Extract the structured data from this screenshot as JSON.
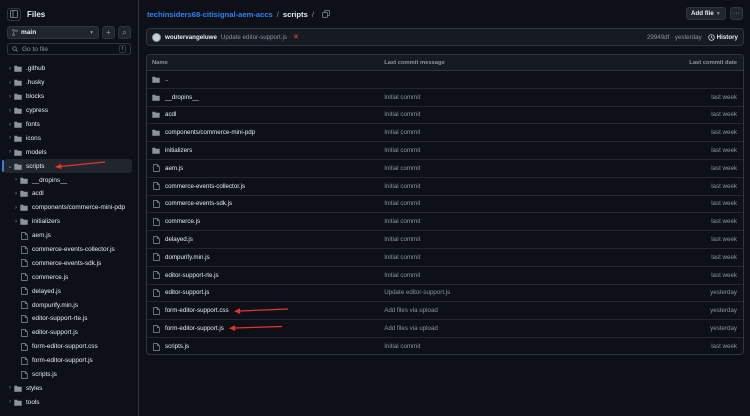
{
  "sidebar": {
    "title": "Files",
    "branch": "main",
    "add_glyph": "+",
    "search_glyph": "⌕",
    "goto_placeholder": "Go to file",
    "goto_kbd": "t",
    "tree": [
      {
        "name": ".github",
        "type": "folder",
        "depth": 0,
        "open": false
      },
      {
        "name": ".husky",
        "type": "folder",
        "depth": 0,
        "open": false
      },
      {
        "name": "blocks",
        "type": "folder",
        "depth": 0,
        "open": false
      },
      {
        "name": "cypress",
        "type": "folder",
        "depth": 0,
        "open": false
      },
      {
        "name": "fonts",
        "type": "folder",
        "depth": 0,
        "open": false
      },
      {
        "name": "icons",
        "type": "folder",
        "depth": 0,
        "open": false
      },
      {
        "name": "models",
        "type": "folder",
        "depth": 0,
        "open": false
      },
      {
        "name": "scripts",
        "type": "folder",
        "depth": 0,
        "open": true,
        "selected": true
      },
      {
        "name": "__dropins__",
        "type": "folder",
        "depth": 1,
        "open": false
      },
      {
        "name": "acdl",
        "type": "folder",
        "depth": 1,
        "open": false
      },
      {
        "name": "components/commerce-mini-pdp",
        "type": "folder",
        "depth": 1,
        "open": false
      },
      {
        "name": "initializers",
        "type": "folder",
        "depth": 1,
        "open": false
      },
      {
        "name": "aem.js",
        "type": "file",
        "depth": 1
      },
      {
        "name": "commerce-events-collector.js",
        "type": "file",
        "depth": 1
      },
      {
        "name": "commerce-events-sdk.js",
        "type": "file",
        "depth": 1
      },
      {
        "name": "commerce.js",
        "type": "file",
        "depth": 1
      },
      {
        "name": "delayed.js",
        "type": "file",
        "depth": 1
      },
      {
        "name": "dompurify.min.js",
        "type": "file",
        "depth": 1
      },
      {
        "name": "editor-support-rte.js",
        "type": "file",
        "depth": 1
      },
      {
        "name": "editor-support.js",
        "type": "file",
        "depth": 1
      },
      {
        "name": "form-editor-support.css",
        "type": "file",
        "depth": 1
      },
      {
        "name": "form-editor-support.js",
        "type": "file",
        "depth": 1
      },
      {
        "name": "scripts.js",
        "type": "file",
        "depth": 1
      },
      {
        "name": "styles",
        "type": "folder",
        "depth": 0,
        "open": false
      },
      {
        "name": "tools",
        "type": "folder",
        "depth": 0,
        "open": false
      }
    ]
  },
  "header": {
    "repo": "techinsiders68-citisignal-aem-accs",
    "sep": "/",
    "dir": "scripts",
    "add_file_label": "Add file",
    "more_glyph": "···"
  },
  "commit": {
    "user": "woutervangeluwe",
    "message": "Update editor-support.js",
    "status_glyph": "✕",
    "sha_time": "29949df · yesterday",
    "history_label": "History"
  },
  "table": {
    "headers": {
      "name": "Name",
      "message": "Last commit message",
      "date": "Last commit date"
    },
    "rows": [
      {
        "name": "..",
        "type": "parent",
        "message": "",
        "date": ""
      },
      {
        "name": "__dropins__",
        "type": "folder",
        "message": "Initial commit",
        "date": "last week"
      },
      {
        "name": "acdl",
        "type": "folder",
        "message": "Initial commit",
        "date": "last week"
      },
      {
        "name": "components/commerce-mini-pdp",
        "type": "folder",
        "message": "Initial commit",
        "date": "last week"
      },
      {
        "name": "initializers",
        "type": "folder",
        "message": "Initial commit",
        "date": "last week"
      },
      {
        "name": "aem.js",
        "type": "file",
        "message": "Initial commit",
        "date": "last week"
      },
      {
        "name": "commerce-events-collector.js",
        "type": "file",
        "message": "Initial commit",
        "date": "last week"
      },
      {
        "name": "commerce-events-sdk.js",
        "type": "file",
        "message": "Initial commit",
        "date": "last week"
      },
      {
        "name": "commerce.js",
        "type": "file",
        "message": "Initial commit",
        "date": "last week"
      },
      {
        "name": "delayed.js",
        "type": "file",
        "message": "Initial commit",
        "date": "last week"
      },
      {
        "name": "dompurify.min.js",
        "type": "file",
        "message": "Initial commit",
        "date": "last week"
      },
      {
        "name": "editor-support-rte.js",
        "type": "file",
        "message": "Initial commit",
        "date": "last week"
      },
      {
        "name": "editor-support.js",
        "type": "file",
        "message": "Update editor-support.js",
        "date": "yesterday"
      },
      {
        "name": "form-editor-support.css",
        "type": "file",
        "message": "Add files via upload",
        "date": "yesterday"
      },
      {
        "name": "form-editor-support.js",
        "type": "file",
        "message": "Add files via upload",
        "date": "yesterday"
      },
      {
        "name": "scripts.js",
        "type": "file",
        "message": "Initial commit",
        "date": "last week"
      }
    ]
  },
  "colors": {
    "accent": "#2f81f7",
    "annotation": "#e5342b",
    "bg": "#0d1117"
  }
}
